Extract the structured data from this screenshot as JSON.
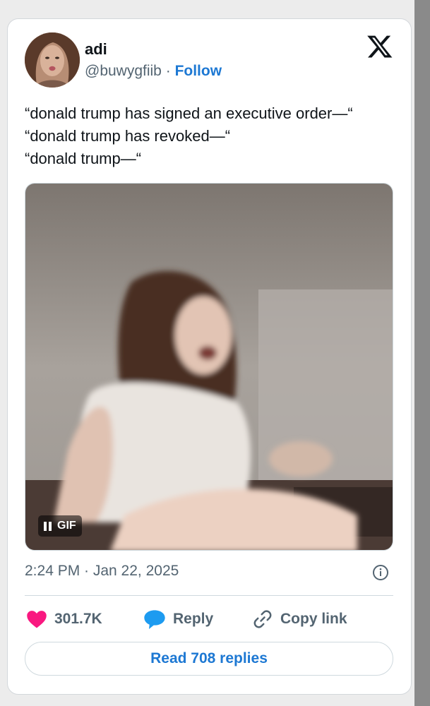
{
  "user": {
    "name": "adi",
    "handle": "@buwygfiib",
    "separator": "·",
    "follow_label": "Follow"
  },
  "tweet": {
    "lines": [
      "“donald trump has signed an executive order—“",
      "“donald trump has revoked—“",
      "“donald trump—“"
    ],
    "media_badge": "GIF",
    "timestamp": "2:24 PM · Jan 22, 2025"
  },
  "actions": {
    "likes": "301.7K",
    "reply_label": "Reply",
    "copy_label": "Copy link"
  },
  "read_replies_label": "Read 708 replies",
  "icons": [
    "x-logo-icon",
    "pause-icon",
    "info-icon",
    "heart-icon",
    "reply-bubble-icon",
    "link-icon"
  ],
  "colors": {
    "follow": "#1d78d3",
    "heart": "#f91880",
    "reply": "#1d9bf0",
    "muted": "#536471"
  }
}
